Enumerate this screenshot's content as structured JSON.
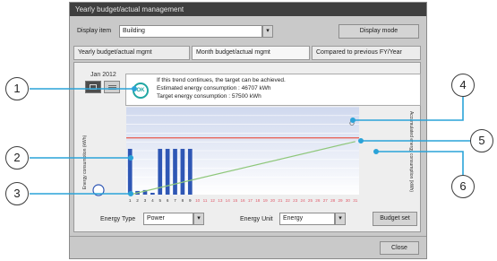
{
  "window": {
    "title": "Yearly budget/actual management"
  },
  "toolbar": {
    "display_item_label": "Display item",
    "display_item_value": "Building",
    "display_mode_label": "Display mode"
  },
  "tabs": [
    {
      "label": "Yearly budget/actual mgmt"
    },
    {
      "label": "Month budget/actual mgmt"
    },
    {
      "label": "Compared to previous FY/Year"
    }
  ],
  "info": {
    "date": "Jan 2012",
    "line1": "If this trend continues, the target can be achieved.",
    "line2": "Estimated energy consumption : 46707 kWh",
    "line3": "Target energy consumption : 57500 kWh"
  },
  "chart_data": {
    "type": "bar",
    "ylabel": "Energy consumption (kWh)",
    "y2label": "Accumulated energy consumption (kWh)",
    "x": [
      "1",
      "2",
      "3",
      "4",
      "5",
      "6",
      "7",
      "8",
      "9",
      "10",
      "11",
      "12",
      "13",
      "14",
      "15",
      "16",
      "17",
      "18",
      "19",
      "20",
      "21",
      "22",
      "23",
      "24",
      "25",
      "26",
      "27",
      "28",
      "29",
      "30",
      "31"
    ],
    "values": [
      2500,
      200,
      250,
      100,
      2500,
      2500,
      2500,
      2500,
      2500,
      0,
      0,
      0,
      0,
      0,
      0,
      0,
      0,
      0,
      0,
      0,
      0,
      0,
      0,
      0,
      0,
      0,
      0,
      0,
      0,
      0,
      0
    ],
    "ylim": [
      0,
      4800
    ],
    "target_line": 3100,
    "trend_line": {
      "from": [
        1,
        0
      ],
      "to": [
        31,
        2900
      ]
    }
  },
  "controls": {
    "energy_type_label": "Energy Type",
    "energy_type_value": "Power",
    "energy_unit_label": "Energy Unit",
    "energy_unit_value": "Energy",
    "budget_set_label": "Budget set",
    "close_label": "Close"
  },
  "callouts": [
    "1",
    "2",
    "3",
    "4",
    "5",
    "6"
  ],
  "colors": {
    "bar": "#2f57b5",
    "bar_future": "#e05a6a",
    "target_line": "#e7675c",
    "trend_line": "#8ec77a",
    "callout_line": "#2aa3d8"
  }
}
